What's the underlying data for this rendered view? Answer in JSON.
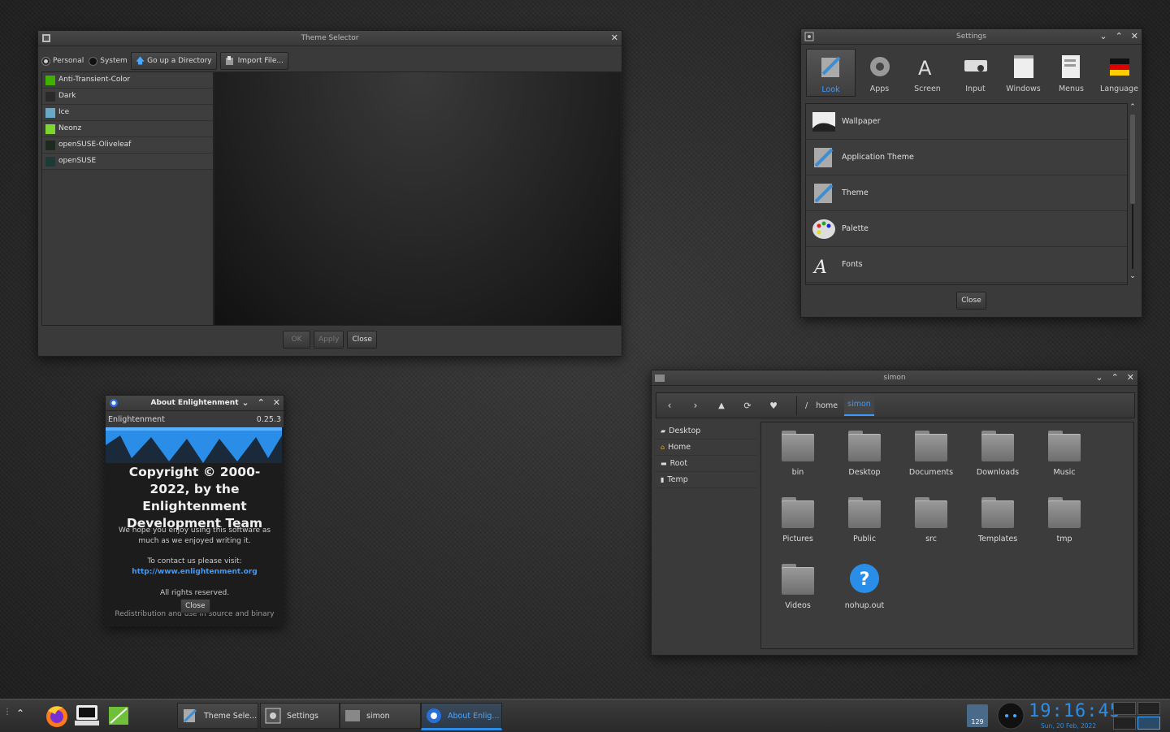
{
  "theme_selector": {
    "title": "Theme Selector",
    "radio_personal": "Personal",
    "radio_system": "System",
    "go_up_label": "Go up a Directory",
    "import_label": "Import File...",
    "themes": [
      {
        "name": "Anti-Transient-Color",
        "color": "#3fb000"
      },
      {
        "name": "Dark",
        "color": "#2a2a2a"
      },
      {
        "name": "Ice",
        "color": "#6aa8c8"
      },
      {
        "name": "Neonz",
        "color": "#7fd430"
      },
      {
        "name": "openSUSE-Oliveleaf",
        "color": "#1f2a1f"
      },
      {
        "name": "openSUSE",
        "color": "#1d3a36"
      }
    ],
    "ok_label": "OK",
    "apply_label": "Apply",
    "close_label": "Close"
  },
  "settings": {
    "title": "Settings",
    "tabs": [
      {
        "label": "Look",
        "icon": "look-icon",
        "active": true
      },
      {
        "label": "Apps",
        "icon": "gear-icon"
      },
      {
        "label": "Screen",
        "icon": "screen-icon"
      },
      {
        "label": "Input",
        "icon": "input-icon"
      },
      {
        "label": "Windows",
        "icon": "windows-icon"
      },
      {
        "label": "Menus",
        "icon": "menus-icon"
      },
      {
        "label": "Language",
        "icon": "language-icon"
      }
    ],
    "items": [
      {
        "label": "Wallpaper",
        "icon": "wallpaper-icon"
      },
      {
        "label": "Application Theme",
        "icon": "app-theme-icon"
      },
      {
        "label": "Theme",
        "icon": "theme-icon"
      },
      {
        "label": "Palette",
        "icon": "palette-icon"
      },
      {
        "label": "Fonts",
        "icon": "fonts-icon"
      }
    ],
    "close_label": "Close"
  },
  "about": {
    "title": "About Enlightenment",
    "app_name": "Enlightenment",
    "version": "0.25.3",
    "copyright": "Copyright © 2000-2022, by the Enlightenment Development Team",
    "message": "We hope you enjoy using this software as much as we enjoyed writing it.",
    "contact_label": "To contact us please visit:",
    "url": "http://www.enlightenment.org",
    "rights": "All rights reserved.",
    "redistribution": "Redistribution and use in source and binary",
    "close_label": "Close"
  },
  "file_manager": {
    "title": "simon",
    "path_root": "/",
    "path": [
      "home",
      "simon"
    ],
    "sidebar": [
      {
        "label": "Desktop",
        "icon": "desktop-icon"
      },
      {
        "label": "Home",
        "icon": "home-icon"
      },
      {
        "label": "Root",
        "icon": "drive-icon"
      },
      {
        "label": "Temp",
        "icon": "temp-icon"
      }
    ],
    "items": [
      {
        "label": "bin",
        "type": "folder"
      },
      {
        "label": "Desktop",
        "type": "folder"
      },
      {
        "label": "Documents",
        "type": "folder"
      },
      {
        "label": "Downloads",
        "type": "folder"
      },
      {
        "label": "Music",
        "type": "folder"
      },
      {
        "label": "Pictures",
        "type": "folder"
      },
      {
        "label": "Public",
        "type": "folder"
      },
      {
        "label": "src",
        "type": "folder"
      },
      {
        "label": "Templates",
        "type": "folder"
      },
      {
        "label": "tmp",
        "type": "folder"
      },
      {
        "label": "Videos",
        "type": "folder"
      },
      {
        "label": "nohup.out",
        "type": "unknown"
      }
    ]
  },
  "taskbar": {
    "tasks": [
      {
        "label": "Theme Sele...",
        "icon": "theme-selector-icon"
      },
      {
        "label": "Settings",
        "icon": "settings-icon"
      },
      {
        "label": "simon",
        "icon": "folder-icon"
      },
      {
        "label": "About Enlig...",
        "icon": "enlightenment-icon",
        "active": true
      }
    ],
    "updates_count": "129",
    "clock_time": "19:16:45",
    "clock_date": "Sun, 20 Feb, 2022"
  }
}
